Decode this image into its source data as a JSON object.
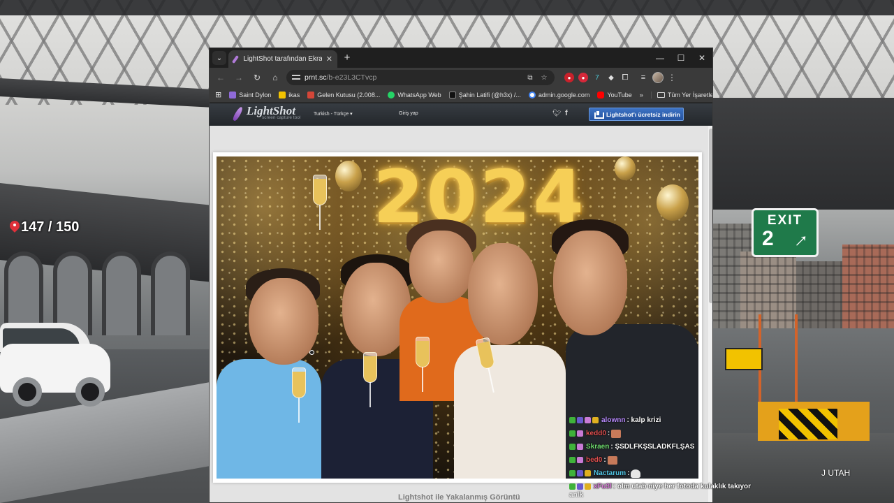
{
  "game": {
    "counter_text": "147 / 150",
    "exit_sign": {
      "word": "EXIT",
      "number": "2"
    },
    "location_label": "J UTAH"
  },
  "browser": {
    "tab_title": "LightShot tarafından Ekran Görü",
    "url_host": "prnt.sc",
    "url_path": "/b-e23L3CTvcp",
    "bookmarks": [
      {
        "label": "Saint Dylon",
        "color": "#8f6ad8"
      },
      {
        "label": "ikas",
        "color": "#f2c200"
      },
      {
        "label": "Gelen Kutusu (2.008...",
        "color": "#d44638"
      },
      {
        "label": "WhatsApp Web",
        "color": "#25d366"
      },
      {
        "label": "Şahin Latifi (@h3x) /...",
        "color": "#e8e8e8"
      },
      {
        "label": "admin.google.com",
        "color": "#4285f4"
      },
      {
        "label": "YouTube",
        "color": "#ff0000"
      }
    ],
    "bookmarks_more": "»",
    "all_bookmarks": "Tüm Yer İşaretleri"
  },
  "lightshot": {
    "logo_name": "LightShot",
    "logo_tagline": "screen capture tool",
    "language": "Turkish - Türkçe",
    "login": "Giriş yap",
    "download_button": "Lightshot'ı ücretsiz indirin",
    "photo_year": "2024",
    "caption": "Lightshot ile Yakalanmış Görüntü"
  },
  "chat": [
    {
      "user": "alownn",
      "user_color": "#b98cff",
      "message": ": kalp krizi"
    },
    {
      "user": "kedd0",
      "user_color": "#e05050",
      "message": ":"
    },
    {
      "user": "Skraen",
      "user_color": "#6fdc6f",
      "message": ": ŞSDLFKŞSLADKFLŞAS"
    },
    {
      "user": "bed0",
      "user_color": "#e05050",
      "message": ":"
    },
    {
      "user": "Nactarum",
      "user_color": "#53c8e8",
      "message": ":"
    },
    {
      "user": "xFu3l",
      "user_color": "#d87ad8",
      "message": ": olm utab niye her fotoda kulaklık takıyor",
      "wrap": "anlk"
    }
  ],
  "colors": {
    "browser_frame": "#1f1f1f",
    "toolbar": "#3a3a3a",
    "lightshot_button": "#2f62b4",
    "exit_sign": "#1f7a4a"
  }
}
